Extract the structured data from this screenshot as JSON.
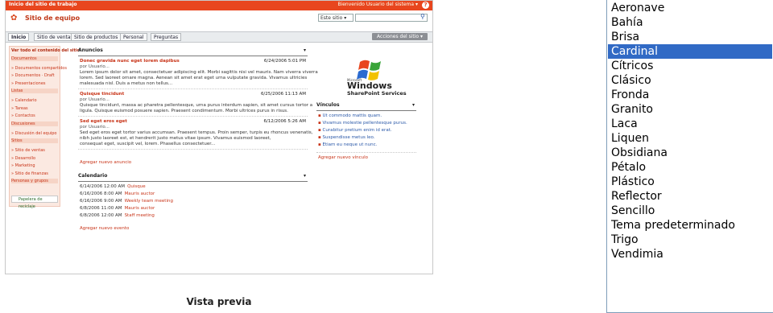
{
  "preview": {
    "titlebar_text": "Inicio del sitio de trabajo",
    "welcome_text": "Bienvenido Usuario del sistema ▾",
    "site_title": "Sitio de equipo",
    "search_scope": "Este sitio ▾",
    "site_actions": "Acciones del sitio ▾",
    "tabs": [
      "Inicio",
      "Sitio de ventas",
      "Sitio de productos",
      "Personal",
      "Preguntas"
    ],
    "nav": [
      {
        "text": "Ver todo el contenido del sitio",
        "kind": "h"
      },
      {
        "text": "Documentos",
        "kind": "sec"
      },
      {
        "text": "» Documentos compartidos",
        "kind": "i"
      },
      {
        "text": "» Documentos · Draft",
        "kind": "i"
      },
      {
        "text": "» Presentaciones",
        "kind": "i"
      },
      {
        "text": "Listas",
        "kind": "sec"
      },
      {
        "text": "» Calendario",
        "kind": "i"
      },
      {
        "text": "» Tareas",
        "kind": "i"
      },
      {
        "text": "» Contactos",
        "kind": "i"
      },
      {
        "text": "Discusiones",
        "kind": "sec"
      },
      {
        "text": "» Discusión del equipo",
        "kind": "i"
      },
      {
        "text": "Sitios",
        "kind": "sec"
      },
      {
        "text": "» Sitio de ventas",
        "kind": "i"
      },
      {
        "text": "» Desarrollo",
        "kind": "i"
      },
      {
        "text": "» Marketing",
        "kind": "i"
      },
      {
        "text": "» Sitio de finanzas",
        "kind": "i"
      },
      {
        "text": "Personas y grupos",
        "kind": "sec"
      }
    ],
    "recycle_bin": "Papelera de reciclaje",
    "announcements": {
      "header": "Anuncios",
      "items": [
        {
          "title": "Donec gravida nunc eget lorem dapibus",
          "date": "6/24/2006 5:01 PM",
          "by": "por Usuario...",
          "body": [
            "Lorem ipsum dolor sit amet, consectetuer adipiscing elit. Morbi sagittis nisi vel mauris. Nam viverra viverra",
            "lorem. Sed laoreet ornare magna. Aenean sit amet erat eget urna vulputate gravida. Vivamus ultricies",
            "malesuada nisl. Duis a metus non tellus..."
          ]
        },
        {
          "title": "Quisque tincidunt",
          "date": "6/25/2006 11:13 AM",
          "by": "por Usuario...",
          "body": [
            "Quisque tincidunt, massa ac pharetra pellentesque, urna purus interdum sapien, sit amet cursus tortor a",
            "ligula. Quisque euismod posuere sapien. Praesent condimentum. Morbi ultrices purus in risus."
          ]
        },
        {
          "title": "Sed eget eros eget",
          "date": "6/12/2006 5:26 AM",
          "by": "por Usuario...",
          "body": [
            "Sed eget eros eget tortor varius accumsan. Praesent tempus. Proin semper, turpis eu rhoncus venenatis,",
            "nibh justo laoreet est, et hendrerit justo metus vitae ipsum. Vivamus euismod laoreet,",
            "consequat eget, suscipit vel, lorem. Phasellus consectetuer..."
          ]
        }
      ],
      "add_link": "Agregar nuevo anuncio"
    },
    "calendar": {
      "header": "Calendario",
      "rows": [
        {
          "when": "6/14/2006 12:00 AM",
          "event": "Quisque"
        },
        {
          "when": "6/16/2006 8:00 AM",
          "event": "Mauris auctor"
        },
        {
          "when": "6/16/2006 9:00 AM",
          "event": "Weekly team meeting"
        },
        {
          "when": "6/8/2006 11:00 AM",
          "event": "Mauris auctor"
        },
        {
          "when": "6/8/2006 12:00 AM",
          "event": "Staff meeting"
        }
      ],
      "add_link": "Agregar nuevo evento"
    },
    "windows_logo": {
      "line1": "Microsoft",
      "line2": "Windows",
      "line3": "SharePoint Services"
    },
    "links": {
      "header": "Vínculos",
      "items": [
        "Ut commodo mattis quam.",
        "Vivamus molestie pellentesque purus.",
        "Curabitur pretium enim id erat.",
        "Suspendisse metus leo.",
        "Etiam eu neque ut nunc."
      ],
      "add_link": "Agregar nuevo vínculo"
    }
  },
  "preview_caption": "Vista previa",
  "theme_list": {
    "options": [
      "Aeronave",
      "Bahía",
      "Brisa",
      "Cardinal",
      "Cítricos",
      "Clásico",
      "Fronda",
      "Granito",
      "Laca",
      "Liquen",
      "Obsidiana",
      "Pétalo",
      "Plástico",
      "Reflector",
      "Sencillo",
      "Tema predeterminado",
      "Trigo",
      "Vendimia"
    ],
    "selected_index": 3
  },
  "colors": {
    "accent": "#e8461e",
    "selection": "#316ac5"
  }
}
